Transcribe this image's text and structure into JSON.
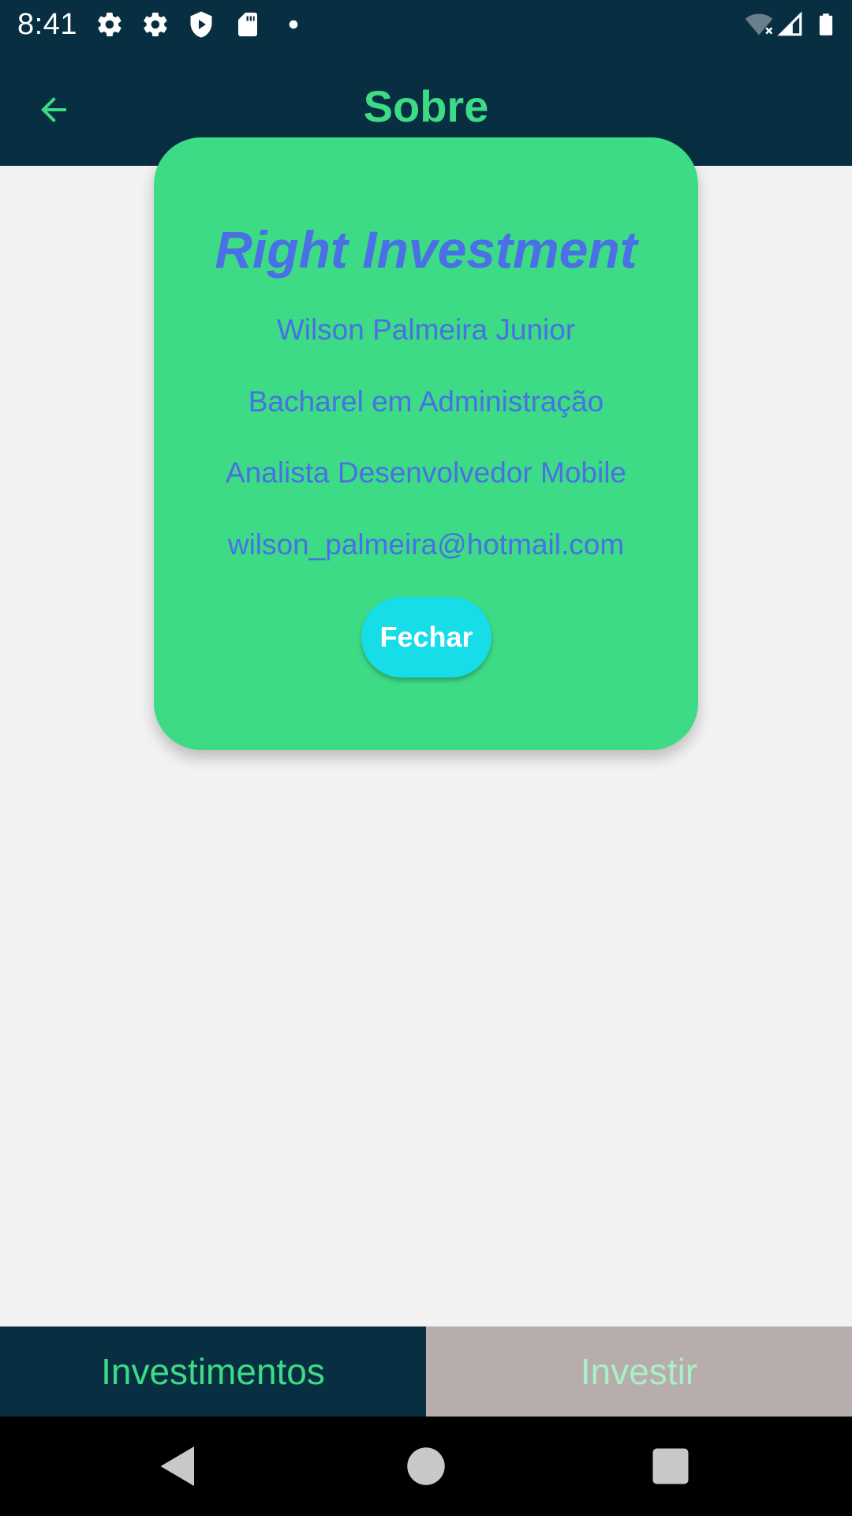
{
  "status_bar": {
    "time": "8:41",
    "icons": [
      "gear-icon",
      "gear-icon",
      "shield-play-icon",
      "sd-card-icon",
      "dot-icon",
      "wifi-off-icon",
      "signal-icon",
      "battery-icon"
    ]
  },
  "app_bar": {
    "title": "Sobre",
    "back_icon": "arrow-left-icon"
  },
  "about_card": {
    "title": "Right Investment",
    "name": "Wilson Palmeira Junior",
    "degree": "Bacharel em Administração",
    "role": "Analista Desenvolvedor Mobile",
    "email": "wilson_palmeira@hotmail.com",
    "close_label": "Fechar"
  },
  "bottom_tabs": {
    "items": [
      {
        "label": "Investimentos"
      },
      {
        "label": "Investir"
      }
    ]
  },
  "nav_bar": {
    "icons": [
      "back-triangle-icon",
      "home-circle-icon",
      "recents-square-icon"
    ]
  },
  "colors": {
    "header_bg": "#082e42",
    "accent_green": "#3ddb85",
    "card_text_blue": "#4a6fe6",
    "button_cyan": "#16dde8",
    "tab_inactive_bg": "#b8adad",
    "page_bg": "#f2f2f2"
  }
}
